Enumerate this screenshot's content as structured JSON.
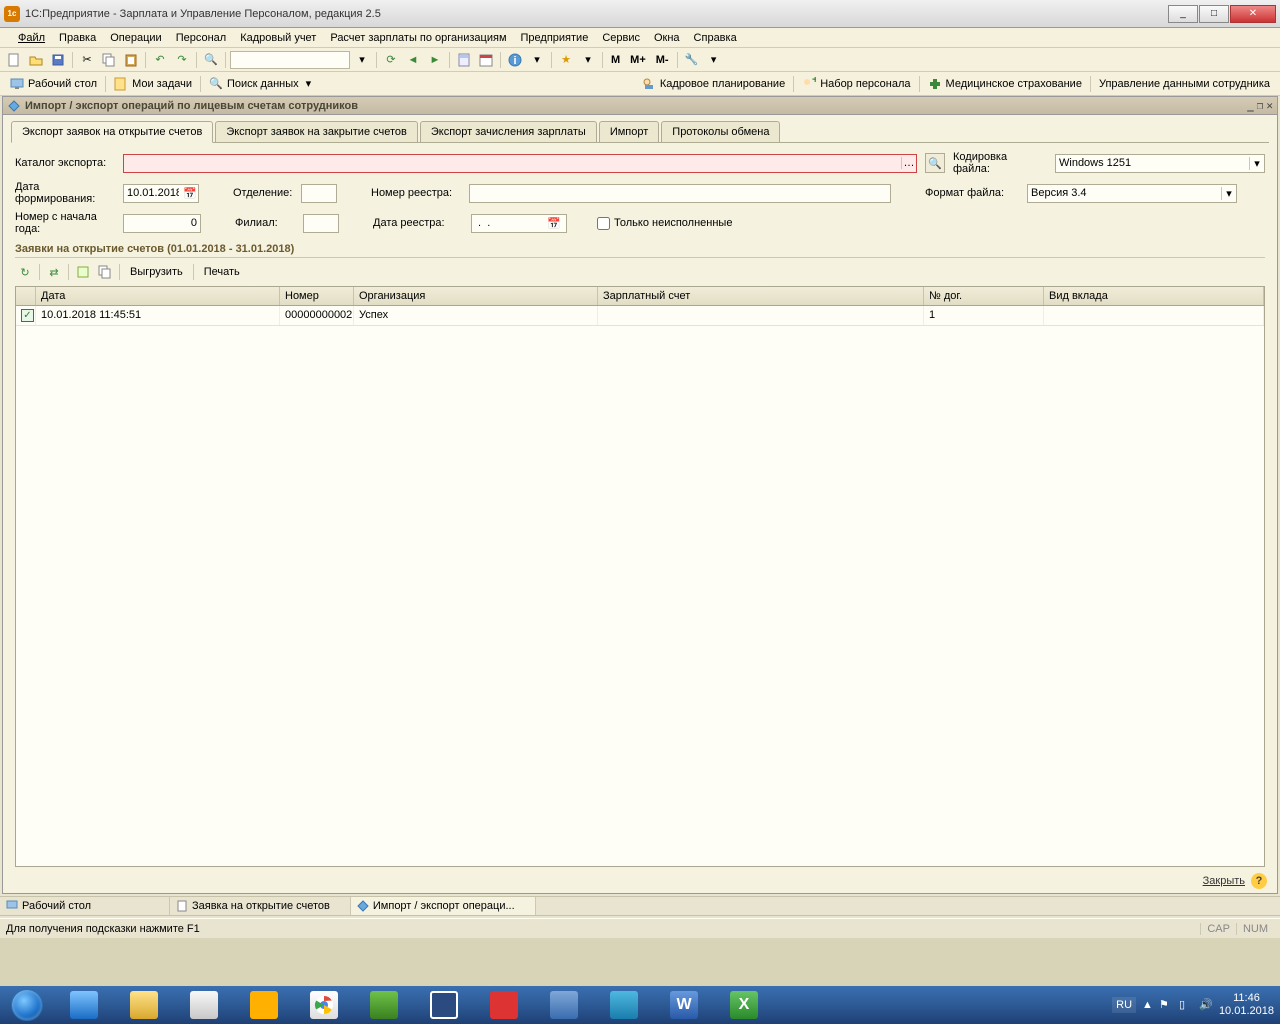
{
  "window_title": "1С:Предприятие - Зарплата и Управление Персоналом, редакция 2.5",
  "menu": [
    "Файл",
    "Правка",
    "Операции",
    "Персонал",
    "Кадровый учет",
    "Расчет зарплаты по организациям",
    "Предприятие",
    "Сервис",
    "Окна",
    "Справка"
  ],
  "toolbar2": {
    "desktop": "Рабочий стол",
    "tasks": "Мои задачи",
    "search": "Поиск данных",
    "kadroplan": "Кадровое планирование",
    "nabor": "Набор персонала",
    "med": "Медицинское страхование",
    "upr": "Управление данными сотрудника"
  },
  "toolbar1_m": {
    "m": "M",
    "mplus": "M+",
    "mminus": "M-"
  },
  "doc": {
    "title": "Импорт / экспорт операций по лицевым счетам сотрудников",
    "tabs": [
      "Экспорт заявок на открытие счетов",
      "Экспорт заявок на закрытие счетов",
      "Экспорт зачисления зарплаты",
      "Импорт",
      "Протоколы обмена"
    ],
    "labels": {
      "catalog": "Каталог экспорта:",
      "encoding": "Кодировка файла:",
      "date_form": "Дата формирования:",
      "branch": "Отделение:",
      "reg_num": "Номер реестра:",
      "format": "Формат файла:",
      "year_num": "Номер с начала года:",
      "filial": "Филиал:",
      "reg_date": "Дата реестра:",
      "only_unexec": "Только неисполненные"
    },
    "values": {
      "catalog": "",
      "encoding": "Windows 1251",
      "date_form": "10.01.2018",
      "branch": "",
      "reg_num": "",
      "format": "Версия 3.4",
      "year_num": "0",
      "filial": "",
      "reg_date": " .  .    "
    },
    "section_title": "Заявки на открытие счетов (01.01.2018 - 31.01.2018)",
    "minibar": {
      "export": "Выгрузить",
      "print": "Печать"
    },
    "grid": {
      "headers": [
        "",
        "Дата",
        "Номер",
        "Организация",
        "Зарплатный счет",
        "№ дог.",
        "Вид вклада"
      ],
      "rows": [
        {
          "checked": true,
          "date": "10.01.2018 11:45:51",
          "num": "00000000002",
          "org": "Успех",
          "acct": "",
          "dog": "1",
          "vkl": ""
        }
      ]
    },
    "close": "Закрыть"
  },
  "mditabs": [
    "Рабочий стол",
    "Заявка на открытие счетов",
    "Импорт / экспорт операци..."
  ],
  "status_hint": "Для получения подсказки нажмите F1",
  "status_cap": "CAP",
  "status_num": "NUM",
  "tray": {
    "lang": "RU",
    "time": "11:46",
    "date": "10.01.2018"
  }
}
